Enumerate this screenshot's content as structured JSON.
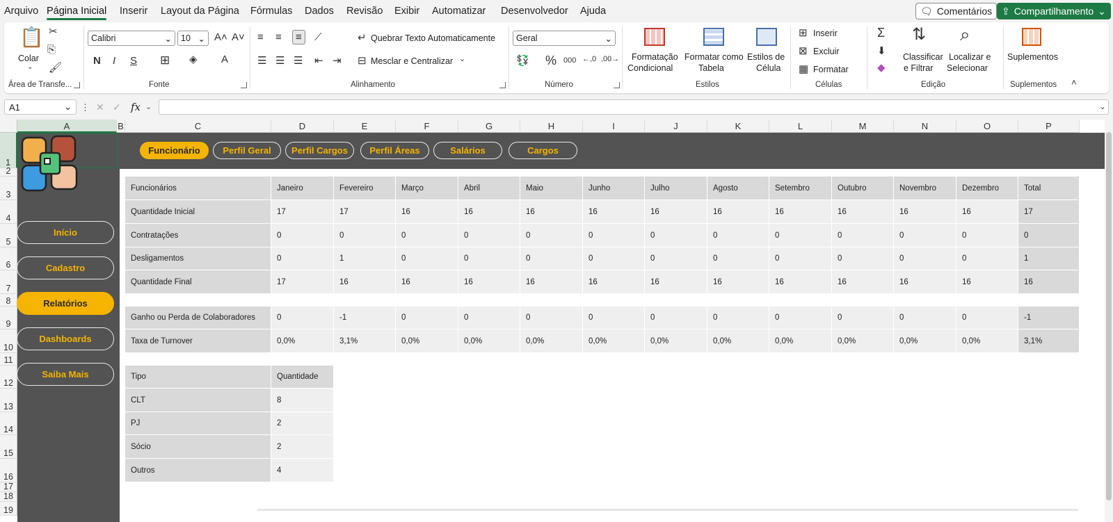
{
  "menu": {
    "tabs": [
      "Arquivo",
      "Página Inicial",
      "Inserir",
      "Layout da Página",
      "Fórmulas",
      "Dados",
      "Revisão",
      "Exibir",
      "Automatizar",
      "Desenvolvedor",
      "Ajuda"
    ],
    "comments": "Comentários",
    "share": "Compartilhamento"
  },
  "ribbon": {
    "paste": "Colar",
    "clipboard": "Área de Transfe...",
    "font_name": "Calibri",
    "font_size": "10",
    "font_group": "Fonte",
    "bold": "N",
    "italic": "I",
    "underline": "S",
    "wrap": "Quebrar Texto Automaticamente",
    "merge": "Mesclar e Centralizar",
    "align_group": "Alinhamento",
    "number_format": "Geral",
    "number_group": "Número",
    "cond_format_1": "Formatação",
    "cond_format_2": "Condicional",
    "format_table_1": "Formatar como",
    "format_table_2": "Tabela",
    "cell_styles_1": "Estilos de",
    "cell_styles_2": "Célula",
    "styles_group": "Estilos",
    "insert": "Inserir",
    "delete": "Excluir",
    "format": "Formatar",
    "cells_group": "Células",
    "sort_1": "Classificar",
    "sort_2": "e Filtrar",
    "find_1": "Localizar e",
    "find_2": "Selecionar",
    "editing_group": "Edição",
    "addins": "Suplementos",
    "addins_group": "Suplementos"
  },
  "formula_bar": {
    "name_box": "A1",
    "fx": "fx",
    "formula": ""
  },
  "columns": [
    "A",
    "B",
    "C",
    "D",
    "E",
    "F",
    "G",
    "H",
    "I",
    "J",
    "K",
    "L",
    "M",
    "N",
    "O",
    "P"
  ],
  "rows": [
    "1",
    "2",
    "3",
    "4",
    "5",
    "6",
    "7",
    "8",
    "9",
    "10",
    "11",
    "12",
    "13",
    "14",
    "15",
    "16",
    "17",
    "18",
    "19"
  ],
  "sidebar": {
    "items": [
      "Início",
      "Cadastro",
      "Relatórios",
      "Dashboards",
      "Saiba Mais"
    ],
    "active": "Relatórios"
  },
  "top_nav": {
    "items": [
      "Funcionário",
      "Perfil Geral",
      "Perfil Cargos",
      "Perfil Áreas",
      "Salários",
      "Cargos"
    ],
    "active": "Funcionário"
  },
  "table1": {
    "headers": [
      "Funcionários",
      "Janeiro",
      "Fevereiro",
      "Março",
      "Abril",
      "Maio",
      "Junho",
      "Julho",
      "Agosto",
      "Setembro",
      "Outubro",
      "Novembro",
      "Dezembro",
      "Total"
    ],
    "rows": [
      [
        "Quantidade Inicial",
        "17",
        "17",
        "16",
        "16",
        "16",
        "16",
        "16",
        "16",
        "16",
        "16",
        "16",
        "16",
        "17"
      ],
      [
        "Contratações",
        "0",
        "0",
        "0",
        "0",
        "0",
        "0",
        "0",
        "0",
        "0",
        "0",
        "0",
        "0",
        "0"
      ],
      [
        "Desligamentos",
        "0",
        "1",
        "0",
        "0",
        "0",
        "0",
        "0",
        "0",
        "0",
        "0",
        "0",
        "0",
        "1"
      ],
      [
        "Quantidade Final",
        "17",
        "16",
        "16",
        "16",
        "16",
        "16",
        "16",
        "16",
        "16",
        "16",
        "16",
        "16",
        "16"
      ]
    ]
  },
  "table2": {
    "rows": [
      [
        "Ganho ou Perda de Colaboradores",
        "0",
        "-1",
        "0",
        "0",
        "0",
        "0",
        "0",
        "0",
        "0",
        "0",
        "0",
        "0",
        "-1"
      ],
      [
        "Taxa de Turnover",
        "0,0%",
        "3,1%",
        "0,0%",
        "0,0%",
        "0,0%",
        "0,0%",
        "0,0%",
        "0,0%",
        "0,0%",
        "0,0%",
        "0,0%",
        "0,0%",
        "3,1%"
      ]
    ]
  },
  "table3": {
    "headers": [
      "Tipo",
      "Quantidade"
    ],
    "rows": [
      [
        "CLT",
        "8"
      ],
      [
        "PJ",
        "2"
      ],
      [
        "Sócio",
        "2"
      ],
      [
        "Outros",
        "4"
      ]
    ]
  },
  "colors": {
    "accent": "#f5b400",
    "dark": "#535353",
    "excel_green": "#1e7a45"
  }
}
